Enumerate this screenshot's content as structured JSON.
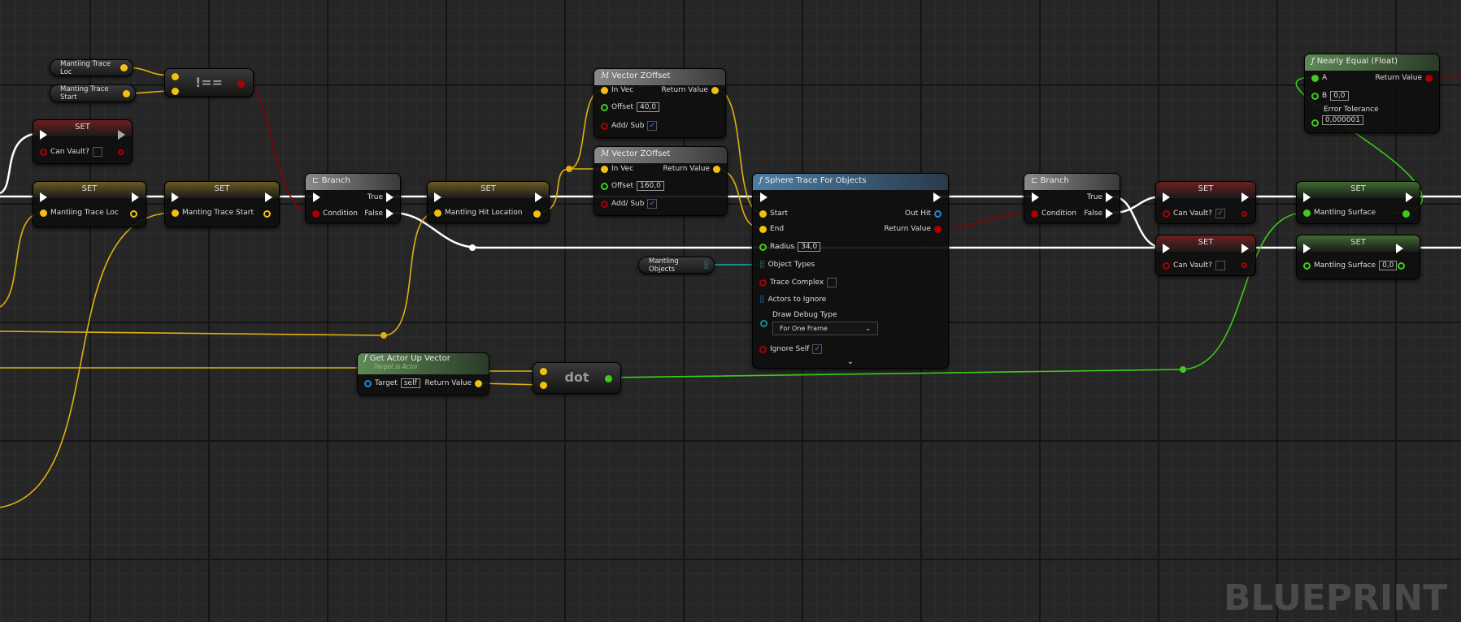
{
  "watermark": "BLUEPRINT",
  "vars": {
    "trace_loc": "Mantiing Trace Loc",
    "trace_start": "Manting Trace Start",
    "mantling_objects": "Mantling Objects"
  },
  "not_equal": {
    "label": "!=="
  },
  "set_can_vault_top": {
    "title": "SET",
    "pin": "Can Vault?"
  },
  "set_trace_loc": {
    "title": "SET",
    "pin": "Mantiing Trace Loc"
  },
  "set_trace_start": {
    "title": "SET",
    "pin": "Manting Trace Start"
  },
  "branch1": {
    "title": "Branch",
    "cond": "Condition",
    "true": "True",
    "false": "False"
  },
  "set_hit_loc": {
    "title": "SET",
    "pin": "Mantling Hit Location"
  },
  "zoffset1": {
    "title": "Vector ZOffset",
    "in": "In Vec",
    "out": "Return Value",
    "offset": "Offset",
    "offset_val": "40,0",
    "addsub": "Add/ Sub"
  },
  "zoffset2": {
    "title": "Vector ZOffset",
    "in": "In Vec",
    "out": "Return Value",
    "offset": "Offset",
    "offset_val": "160,0",
    "addsub": "Add/ Sub"
  },
  "sphere": {
    "title": "Sphere Trace For Objects",
    "start": "Start",
    "end": "End",
    "outhit": "Out Hit",
    "ret": "Return Value",
    "radius": "Radius",
    "radius_val": "34,0",
    "objtypes": "Object Types",
    "complex": "Trace Complex",
    "ignore": "Actors to Ignore",
    "debug": "Draw Debug Type",
    "debug_val": "For One Frame",
    "self": "Ignore Self"
  },
  "upvec": {
    "title": "Get Actor Up Vector",
    "sub": "Target is Actor",
    "target": "Target",
    "target_val": "self",
    "ret": "Return Value"
  },
  "dot": {
    "label": "dot"
  },
  "branch2": {
    "title": "Branch",
    "cond": "Condition",
    "true": "True",
    "false": "False"
  },
  "set_cv_true": {
    "title": "SET",
    "pin": "Can Vault?"
  },
  "set_cv_false": {
    "title": "SET",
    "pin": "Can Vault?"
  },
  "set_ms": {
    "title": "SET",
    "pin": "Mantling Surface"
  },
  "set_ms0": {
    "title": "SET",
    "pin": "Mantling Surface",
    "val": "0,0"
  },
  "nearly": {
    "title": "Nearly Equal (Float)",
    "a": "A",
    "b": "B",
    "b_val": "0,0",
    "tol": "Error Tolerance",
    "tol_val": "0,000001",
    "ret": "Return Value"
  },
  "colors": {
    "exec": "#ffffff",
    "vector": "#f2c010",
    "bool": "#a00000",
    "float": "#3fcc18",
    "object": "#1a8a8a"
  }
}
